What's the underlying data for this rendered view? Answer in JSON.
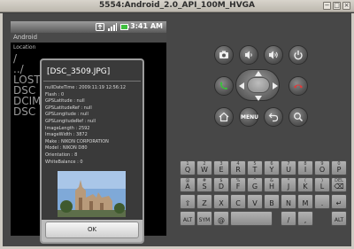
{
  "window": {
    "title": "5554:Android_2.0_API_100M_HVGA",
    "close_glyph": "×",
    "minimize_glyph": "−",
    "maximize_glyph": "□"
  },
  "statusbar": {
    "time": "3:41 AM"
  },
  "app": {
    "title": "Android",
    "location_label": "Location",
    "background_rows": [
      "/",
      "../",
      "LOST",
      "DSC",
      "DCIM",
      "DSC"
    ]
  },
  "dialog": {
    "title": "[DSC_3509.JPG]",
    "info_lines": [
      "nullDateTime : 2009:11:19 12:56:12",
      "Flash : 0",
      "GPSLatitude : null",
      "GPSLatitudeRef : null",
      "GPSLongitude : null",
      "GPSLongitudeRef : null",
      "ImageLength : 2592",
      "ImageWidth : 3872",
      "Make : NIKON CORPORATION",
      "Model : NIKON D80",
      "Orientation : 8",
      "WhiteBalance : 0"
    ],
    "ok_label": "OK"
  },
  "controls": {
    "menu_label": "MENU"
  },
  "keyboard": {
    "row1": [
      {
        "num": "1",
        "label": "Q"
      },
      {
        "num": "2",
        "label": "W"
      },
      {
        "num": "3",
        "label": "E"
      },
      {
        "num": "4",
        "label": "R"
      },
      {
        "num": "5",
        "label": "T"
      },
      {
        "num": "6",
        "label": "Y"
      },
      {
        "num": "7",
        "label": "U"
      },
      {
        "num": "8",
        "label": "I"
      },
      {
        "num": "9",
        "label": "O"
      },
      {
        "num": "0",
        "label": "P"
      }
    ],
    "row2": [
      {
        "num": "@",
        "label": "A"
      },
      {
        "num": "#",
        "label": "S"
      },
      {
        "num": "$",
        "label": "D"
      },
      {
        "num": "%",
        "label": "F"
      },
      {
        "num": "^",
        "label": "G"
      },
      {
        "num": "&",
        "label": "H"
      },
      {
        "num": "*",
        "label": "J"
      },
      {
        "num": "(",
        "label": "K"
      },
      {
        "num": ")",
        "label": "L"
      },
      {
        "num": "DEL",
        "label": "⌫"
      }
    ],
    "row3": [
      {
        "num": "",
        "label": "⇧"
      },
      {
        "num": "",
        "label": "Z"
      },
      {
        "num": "",
        "label": "X"
      },
      {
        "num": "",
        "label": "C"
      },
      {
        "num": "",
        "label": "V"
      },
      {
        "num": "",
        "label": "B"
      },
      {
        "num": "",
        "label": "N"
      },
      {
        "num": "",
        "label": "M"
      },
      {
        "num": "",
        "label": "."
      },
      {
        "num": "",
        "label": "↵"
      }
    ],
    "row4": {
      "alt_left": "ALT",
      "sym": "SYM",
      "at": "@",
      "slash": "/",
      "comma": ",",
      "alt_right": "ALT"
    }
  }
}
